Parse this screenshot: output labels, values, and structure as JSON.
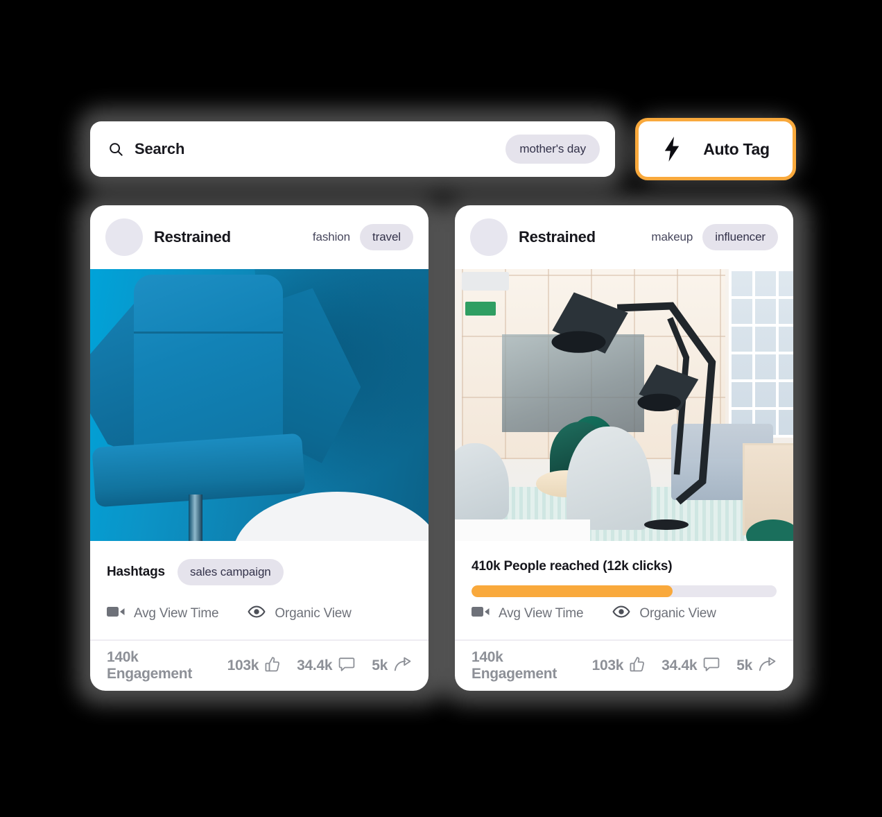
{
  "search": {
    "icon": "search-icon",
    "label": "Search",
    "placeholder": "Search",
    "chip": "mother's day"
  },
  "auto_tag": {
    "icon": "lightning-bolt-icon",
    "label": "Auto Tag",
    "border_color": "#f9a93c"
  },
  "colors": {
    "background": "#000000",
    "card": "#ffffff",
    "pill_bg": "#e5e3ec",
    "pill_text": "#33324a",
    "accent_orange": "#f9a93c",
    "muted_text": "#8d9097"
  },
  "cards": [
    {
      "author": "Restrained",
      "avatar": "avatar-placeholder",
      "tag_plain": "fashion",
      "tag_pill": "travel",
      "image": "blue-armchair-photo",
      "body_type": "hashtags",
      "hashtags_label": "Hashtags",
      "hashtags_pill": "sales campaign",
      "metrics": [
        {
          "icon": "video-camera-icon",
          "label": "Avg View Time"
        },
        {
          "icon": "eye-icon",
          "label": "Organic View"
        }
      ],
      "engagement": "140k Engagement",
      "reactions": [
        {
          "icon": "thumbs-up-icon",
          "count": "103k"
        },
        {
          "icon": "comment-icon",
          "count": "34.4k"
        },
        {
          "icon": "share-icon",
          "count": "5k"
        }
      ]
    },
    {
      "author": "Restrained",
      "avatar": "avatar-placeholder",
      "tag_plain": "makeup",
      "tag_pill": "influencer",
      "image": "office-lounge-photo",
      "body_type": "reach",
      "reach_label": "410k People reached (12k clicks)",
      "progress_percent": 66,
      "metrics": [
        {
          "icon": "video-camera-icon",
          "label": "Avg View Time"
        },
        {
          "icon": "eye-icon",
          "label": "Organic View"
        }
      ],
      "engagement": "140k Engagement",
      "reactions": [
        {
          "icon": "thumbs-up-icon",
          "count": "103k"
        },
        {
          "icon": "comment-icon",
          "count": "34.4k"
        },
        {
          "icon": "share-icon",
          "count": "5k"
        }
      ]
    }
  ]
}
